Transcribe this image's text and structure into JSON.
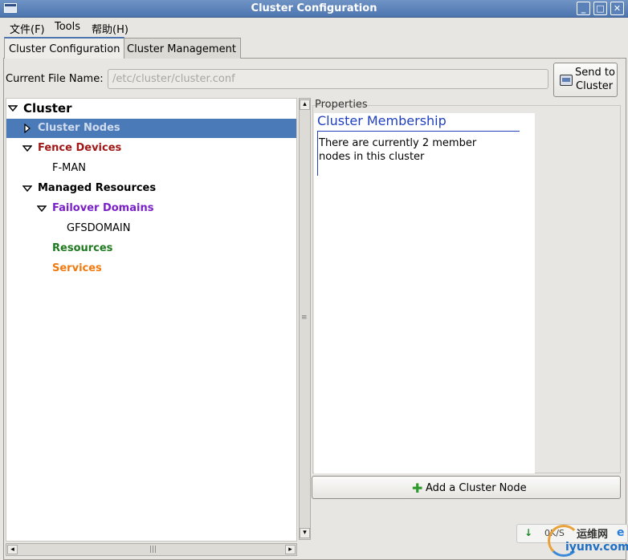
{
  "window": {
    "title": "Cluster Configuration"
  },
  "menubar": {
    "items": [
      "文件(F)",
      "Tools",
      "帮助(H)"
    ]
  },
  "tabs": [
    {
      "label": "Cluster Configuration",
      "active": true
    },
    {
      "label": "Cluster Management",
      "active": false
    }
  ],
  "file": {
    "label": "Current File Name:",
    "value": "/etc/cluster/cluster.conf"
  },
  "send_button": {
    "line1": "Send to",
    "line2": "Cluster"
  },
  "tree": {
    "root": "Cluster",
    "cluster_nodes": "Cluster Nodes",
    "fence_devices": "Fence Devices",
    "fence_child": "F-MAN",
    "managed_resources": "Managed Resources",
    "failover_domains": "Failover Domains",
    "failover_child": "GFSDOMAIN",
    "resources": "Resources",
    "services": "Services"
  },
  "colors": {
    "selection": "#4a7ab8",
    "fence": "#a01818",
    "failover": "#7a1fc8",
    "resources": "#1e7a1e",
    "services": "#f07a10",
    "props_title": "#1f3fc0"
  },
  "properties": {
    "label": "Properties",
    "title": "Cluster Membership",
    "text": "There are currently 2 member nodes in this cluster"
  },
  "add_button": {
    "label": "Add a Cluster Node"
  },
  "watermark": {
    "speed": "0K/S",
    "brand": "运维网",
    "url": "iyunv.com"
  }
}
